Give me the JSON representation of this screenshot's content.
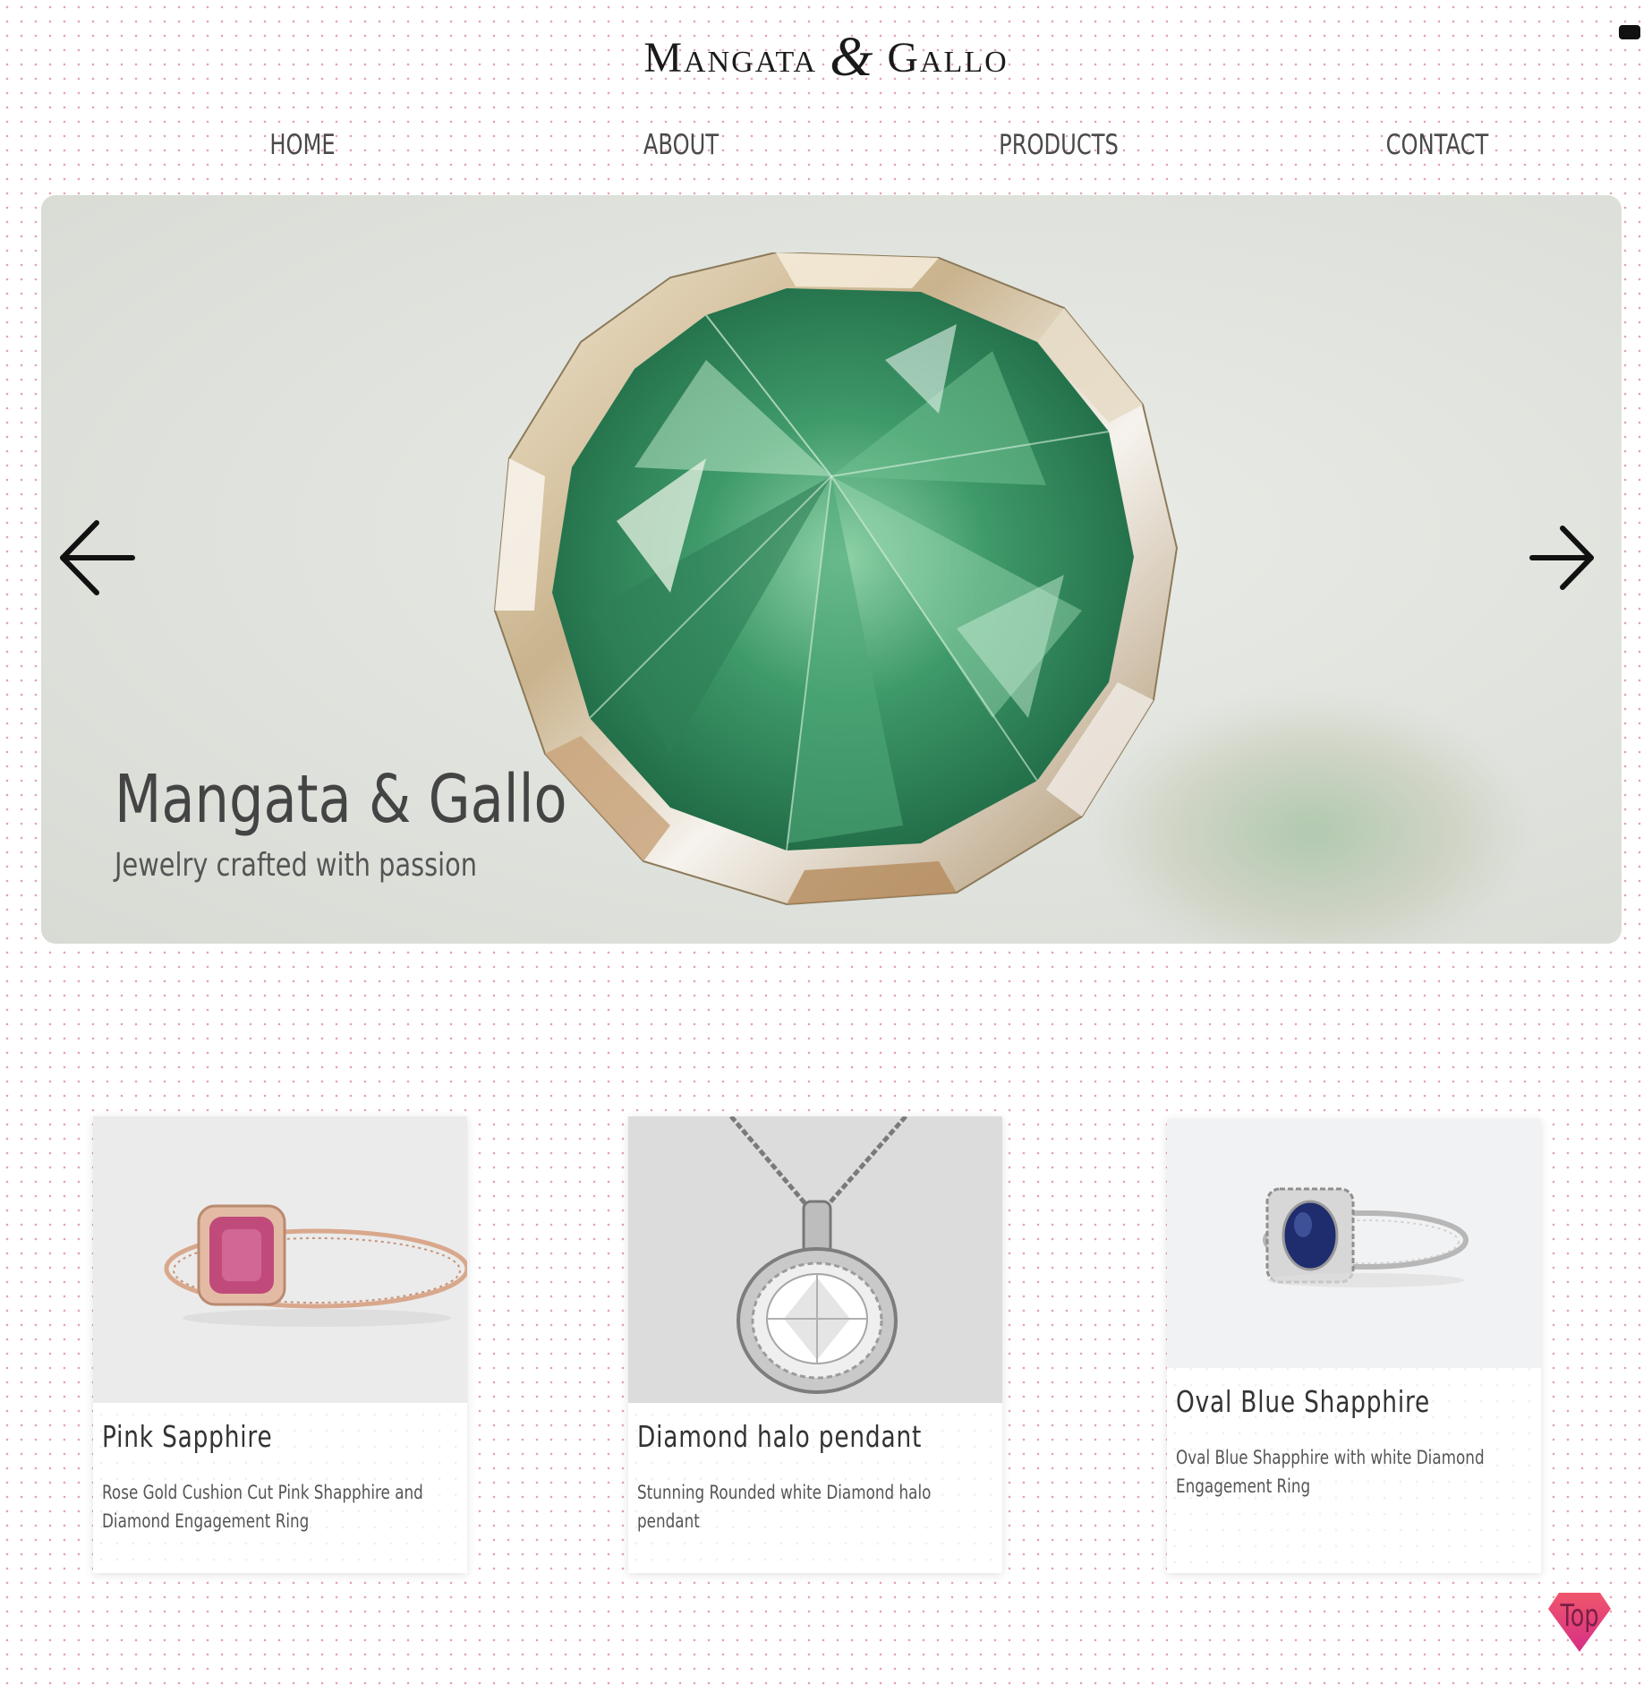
{
  "brand": {
    "logo_left": "Mangata",
    "logo_amp": "&",
    "logo_right": "Gallo"
  },
  "nav": {
    "items": [
      "HOME",
      "ABOUT",
      "PRODUCTS",
      "CONTACT"
    ]
  },
  "hero": {
    "title": "Mangata & Gallo",
    "subtitle": "Jewelry crafted with passion",
    "prev_icon": "arrow-left-icon",
    "next_icon": "arrow-right-icon"
  },
  "products": [
    {
      "title": "Pink Sapphire",
      "description": "Rose Gold Cushion Cut Pink Shapphire and Diamond Engagement Ring"
    },
    {
      "title": "Diamond halo pendant",
      "description": "Stunning Rounded white Diamond halo pendant"
    },
    {
      "title": "Oval Blue Shapphire",
      "description": "Oval Blue Shapphire with white Diamond Engagement Ring"
    }
  ],
  "back_to_top": {
    "label": "Top"
  },
  "colors": {
    "dot_pattern": "#e3a3ad",
    "gem_green": "#3f9a6a",
    "top_button": "#e8456f"
  }
}
